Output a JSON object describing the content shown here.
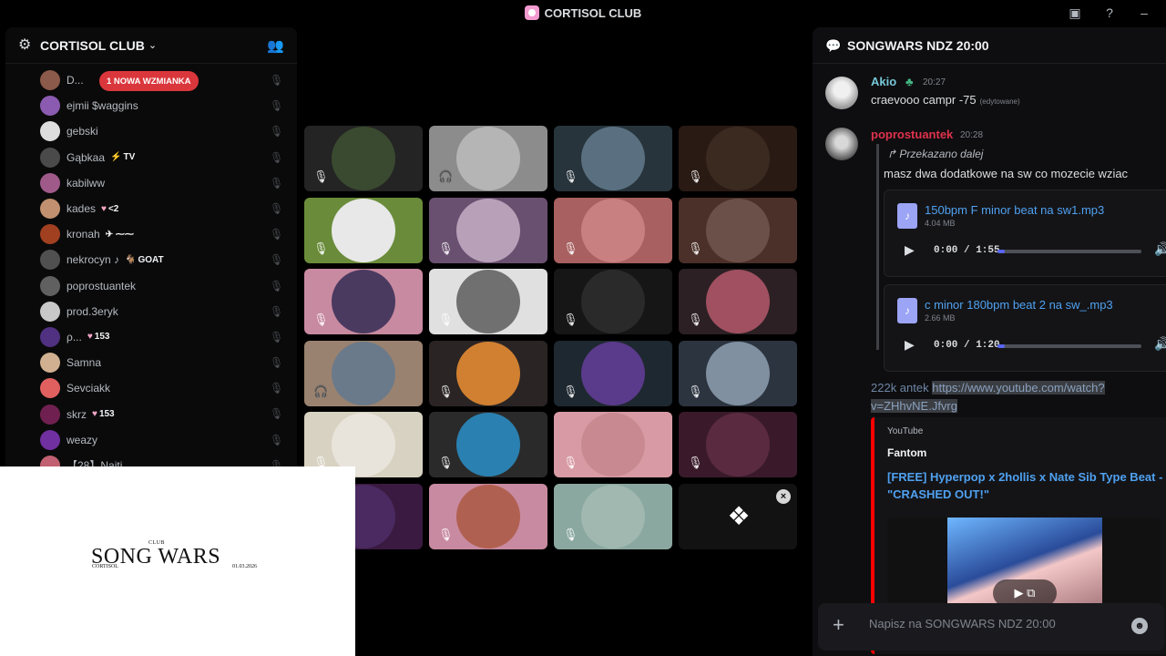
{
  "window": {
    "title": "CORTISOL CLUB",
    "actions": [
      {
        "icon": "inbox-icon",
        "glyph": "▣"
      },
      {
        "icon": "help-icon",
        "glyph": "?"
      },
      {
        "icon": "minimize-icon",
        "glyph": "–"
      }
    ]
  },
  "server": {
    "name": "CORTISOL CLUB",
    "mention_pill": "1 NOWA WZMIANKA",
    "members": [
      {
        "name": "D...",
        "color": "#8b5a4a",
        "tag": "",
        "tag_icon": ""
      },
      {
        "name": "ejmii $waggins",
        "color": "#8a5bb0",
        "tag": "",
        "tag_icon": ""
      },
      {
        "name": "gebski",
        "color": "#dddddd",
        "tag": "",
        "tag_icon": ""
      },
      {
        "name": "Gąbkaa",
        "color": "#4a4a4a",
        "tag": "TV",
        "tag_icon": "⚡"
      },
      {
        "name": "kabilww",
        "color": "#a05a8a",
        "tag": "",
        "tag_icon": ""
      },
      {
        "name": "kades",
        "color": "#c09070",
        "tag": "<2",
        "tag_icon": "♥"
      },
      {
        "name": "kronah",
        "color": "#a04020",
        "tag": "✈ ⁓⁓",
        "tag_icon": ""
      },
      {
        "name": "nekrocyn ♪",
        "color": "#505050",
        "tag": "GOAT",
        "tag_icon": "🐐"
      },
      {
        "name": "poprostuantek",
        "color": "#606060",
        "tag": "",
        "tag_icon": ""
      },
      {
        "name": "prod.3eryk",
        "color": "#c8c8c8",
        "tag": "",
        "tag_icon": ""
      },
      {
        "name": "ρ...",
        "color": "#503080",
        "tag": "153",
        "tag_icon": "♥"
      },
      {
        "name": "Samna",
        "color": "#d0b090",
        "tag": "",
        "tag_icon": ""
      },
      {
        "name": "Sevciakk",
        "color": "#e06060",
        "tag": "",
        "tag_icon": ""
      },
      {
        "name": "skrz",
        "color": "#702050",
        "tag": "153",
        "tag_icon": "♥"
      },
      {
        "name": "weazy",
        "color": "#7030a0",
        "tag": "",
        "tag_icon": ""
      },
      {
        "name": "【28】Naiti",
        "color": "#c06070",
        "tag": "",
        "tag_icon": ""
      }
    ]
  },
  "video_grid": {
    "tiles": [
      {
        "bg": "#242424",
        "avatar": "#3a4a30",
        "muted_icon": "mic-muted-icon"
      },
      {
        "bg": "#8c8c8c",
        "avatar": "#b5b5b5",
        "muted_icon": "deafened-icon"
      },
      {
        "bg": "#27343c",
        "avatar": "#5a7080",
        "muted_icon": "mic-muted-icon"
      },
      {
        "bg": "#2a1a14",
        "avatar": "#3a2a20",
        "muted_icon": "mic-muted-icon"
      },
      {
        "bg": "#6a8c3a",
        "avatar": "#e8e8e8",
        "muted_icon": "mic-muted-icon"
      },
      {
        "bg": "#6a5070",
        "avatar": "#b8a0b8",
        "muted_icon": "mic-muted-icon"
      },
      {
        "bg": "#a86060",
        "avatar": "#c88080",
        "muted_icon": "mic-muted-icon"
      },
      {
        "bg": "#4a3028",
        "avatar": "#6a5048",
        "muted_icon": "mic-muted-icon"
      },
      {
        "bg": "#c88aa0",
        "avatar": "#4a3a60",
        "muted_icon": "mic-muted-icon"
      },
      {
        "bg": "#e0e0e0",
        "avatar": "#707070",
        "muted_icon": "mic-muted-icon"
      },
      {
        "bg": "#161616",
        "avatar": "#2a2a2a",
        "muted_icon": "mic-muted-icon"
      },
      {
        "bg": "#2c2024",
        "avatar": "#a05060",
        "muted_icon": "mic-muted-icon"
      },
      {
        "bg": "#9a8270",
        "avatar": "#6a7a8a",
        "muted_icon": "deafened-icon"
      },
      {
        "bg": "#2a2424",
        "avatar": "#d08030",
        "muted_icon": "mic-muted-icon"
      },
      {
        "bg": "#1e2830",
        "avatar": "#5a3a8a",
        "muted_icon": "mic-muted-icon"
      },
      {
        "bg": "#2c3440",
        "avatar": "#8090a0",
        "muted_icon": "mic-muted-icon"
      },
      {
        "bg": "#d8d2c2",
        "avatar": "#e8e4dc",
        "muted_icon": "mic-muted-icon"
      },
      {
        "bg": "#2a2a2a",
        "avatar": "#2a80b0",
        "muted_icon": "mic-muted-icon"
      },
      {
        "bg": "#d89aa4",
        "avatar": "#c88a90",
        "muted_icon": "mic-muted-icon"
      },
      {
        "bg": "#3a1a2a",
        "avatar": "#5a2a40",
        "muted_icon": "mic-muted-icon"
      },
      {
        "bg": "#3a1a40",
        "avatar": "#4a2a60",
        "muted_icon": "mic-muted-icon"
      },
      {
        "bg": "#c88aa0",
        "avatar": "#b06050",
        "muted_icon": "mic-muted-icon"
      },
      {
        "bg": "#8aa8a0",
        "avatar": "#a0b8b0",
        "muted_icon": "mic-muted-icon"
      }
    ]
  },
  "overlay": {
    "club": "CLUB",
    "title": "SONG WARS",
    "subtitle_left": "CORTISOL",
    "subtitle_right": "01.03.2026"
  },
  "chat": {
    "channel": "SONGWARS NDZ 20:00",
    "messages": {
      "akio": {
        "author": "Akio",
        "author_color": "#76c8d8",
        "badge": "♣",
        "time": "20:27",
        "text": "craevooo campr -75",
        "edited": "(edytowane)"
      },
      "antek": {
        "author": "poprostuantek",
        "author_color": "#e0324c",
        "time": "20:28",
        "forward_label": "Przekazano dalej",
        "forward_text": "masz dwa dodatkowe na sw co mozecie wziac",
        "files": [
          {
            "name": "150bpm F minor beat na sw1.mp3",
            "size": "4.04 MB",
            "time": "0:00 / 1:55",
            "progress": 0.05
          },
          {
            "name": "c minor 180bpm beat 2 na sw_.mp3",
            "size": "2.66 MB",
            "time": "0:00 / 1:20",
            "progress": 0.05
          }
        ],
        "link_prefix": "222k antek",
        "link_url": "https://www.youtube.com/watch?v=ZHhvNE.Jfvrg",
        "embed": {
          "provider": "YouTube",
          "author": "Fantom",
          "title": "[FREE] Hyperpop x 2hollis x Nate Sib Type Beat - \"CRASHED OUT!\""
        }
      }
    },
    "composer_placeholder": "Napisz na SONGWARS NDZ 20:00"
  }
}
